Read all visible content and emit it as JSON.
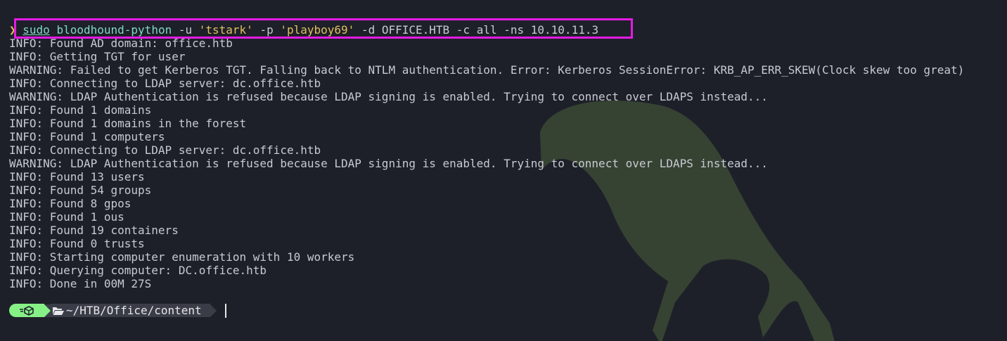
{
  "command": {
    "prompt_symbol": "❯",
    "sudo": "sudo",
    "program": "bloodhound-python",
    "args_1": " -u ",
    "user": "'tstark'",
    "args_2": " -p ",
    "password": "'playboy69'",
    "args_3": " -d OFFICE.HTB -c all -ns 10.10.11.3"
  },
  "output_lines": [
    "INFO: Found AD domain: office.htb",
    "INFO: Getting TGT for user",
    "WARNING: Failed to get Kerberos TGT. Falling back to NTLM authentication. Error: Kerberos SessionError: KRB_AP_ERR_SKEW(Clock skew too great)",
    "INFO: Connecting to LDAP server: dc.office.htb",
    "WARNING: LDAP Authentication is refused because LDAP signing is enabled. Trying to connect over LDAPS instead...",
    "INFO: Found 1 domains",
    "INFO: Found 1 domains in the forest",
    "INFO: Found 1 computers",
    "INFO: Connecting to LDAP server: dc.office.htb",
    "WARNING: LDAP Authentication is refused because LDAP signing is enabled. Trying to connect over LDAPS instead...",
    "INFO: Found 13 users",
    "INFO: Found 54 groups",
    "INFO: Found 8 gpos",
    "INFO: Found 1 ous",
    "INFO: Found 19 containers",
    "INFO: Found 0 trusts",
    "INFO: Starting computer enumeration with 10 workers",
    "INFO: Querying computer: DC.office.htb",
    "INFO: Done in 00M 27S"
  ],
  "prompt": {
    "status_icon": "package-icon",
    "folder_icon": "folder-open-icon",
    "path": "~/HTB/Office/content"
  },
  "colors": {
    "background": "#1e2029",
    "highlight_border": "#e41be4",
    "status_segment": "#86f087",
    "path_segment": "#3a3d48",
    "watermark": "#3b4a35"
  }
}
